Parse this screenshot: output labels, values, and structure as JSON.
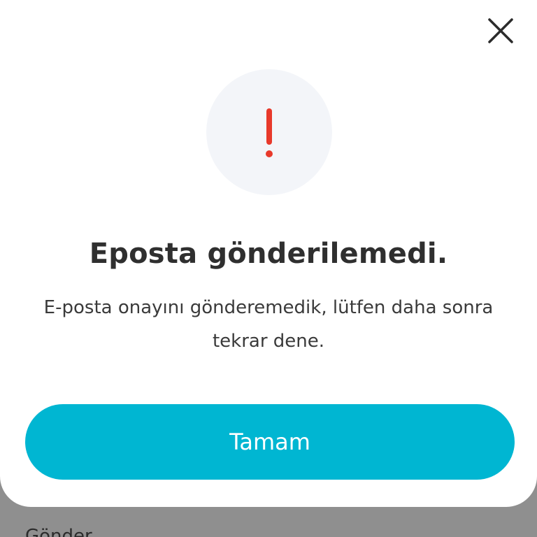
{
  "background": {
    "partial_text": "Gönder"
  },
  "dialog": {
    "close_icon": "close-icon",
    "alert_icon": "exclamation-icon",
    "title": "Eposta gönderilemedi.",
    "message": "E-posta onayını gönderemedik, lütfen daha sonra tekrar dene.",
    "button_label": "Tamam"
  },
  "colors": {
    "accent": "#00b6d2",
    "alert": "#e8392b",
    "icon_circle": "#f3f5f9",
    "overlay": "#8f8f8f"
  }
}
